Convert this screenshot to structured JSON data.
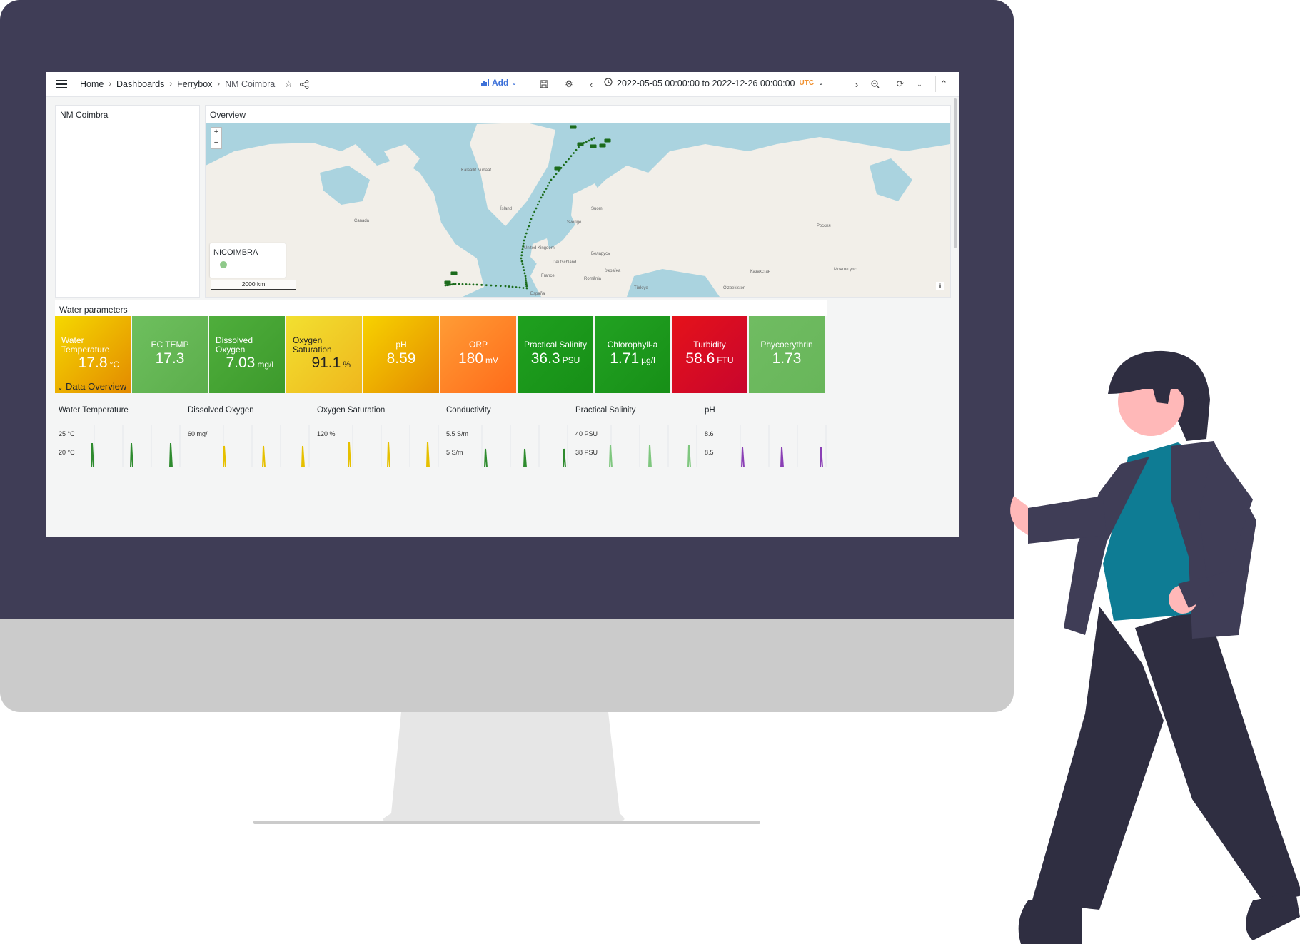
{
  "topbar": {
    "breadcrumbs": [
      "Home",
      "Dashboards",
      "Ferrybox",
      "NM Coimbra"
    ],
    "add_label": "Add",
    "time_range": "2022-05-05 00:00:00 to 2022-12-26 00:00:00",
    "timezone": "UTC"
  },
  "panels": {
    "text_panel_title": "NM Coimbra",
    "overview_title": "Overview",
    "map": {
      "zoom_in": "+",
      "zoom_out": "−",
      "legend_name": "NICOIMBRA",
      "scale_label": "2000 km",
      "info": "i",
      "labels": {
        "greenland": "Kalaallit Nunaat",
        "iceland": "Ísland",
        "canada": "Canada",
        "russia": "Россия",
        "kazakhstan": "Казахстан",
        "mongolia": "Монгол улс",
        "france": "France",
        "deutschland": "Deutschland",
        "uk": "United Kingdom",
        "ukraine": "Україна",
        "sverige": "Sverige",
        "suomi": "Suomi",
        "espana": "España",
        "belarus": "Беларусь",
        "romania": "România",
        "turkey": "Türkiye",
        "uzbek": "O'zbekiston"
      }
    },
    "water_title": "Water parameters",
    "tiles": [
      {
        "label1": "Water",
        "label2": "Temperature",
        "value": "17.8",
        "unit": "°C",
        "color1": "#f5d800",
        "color2": "#e38a00"
      },
      {
        "label1": "EC TEMP",
        "label2": "",
        "value": "17.3",
        "unit": "",
        "color1": "#6ebf5e",
        "color2": "#5cae4c"
      },
      {
        "label1": "Dissolved",
        "label2": "Oxygen",
        "value": "7.03",
        "unit": "mg/l",
        "color1": "#4fae3c",
        "color2": "#3d9a2c"
      },
      {
        "label1": "Oxygen",
        "label2": "Saturation",
        "value": "91.1",
        "unit": "%",
        "color1": "#f2e030",
        "color2": "#efb71d"
      },
      {
        "label1": "pH",
        "label2": "",
        "value": "8.59",
        "unit": "",
        "color1": "#f7d200",
        "color2": "#e48b00"
      },
      {
        "label1": "ORP",
        "label2": "",
        "value": "180",
        "unit": "mV",
        "color1": "#ff9c35",
        "color2": "#ff6b1a"
      },
      {
        "label1": "Practical Salinity",
        "label2": "",
        "value": "36.3",
        "unit": "PSU",
        "color1": "#1fa01f",
        "color2": "#178f17"
      },
      {
        "label1": "Chlorophyll-a",
        "label2": "",
        "value": "1.71",
        "unit": "µg/l",
        "color1": "#22a222",
        "color2": "#178f17"
      },
      {
        "label1": "Turbidity",
        "label2": "",
        "value": "58.6",
        "unit": "FTU",
        "color1": "#e5121a",
        "color2": "#c8052d"
      },
      {
        "label1": "Phycoerythrin",
        "label2": "",
        "value": "1.73",
        "unit": "",
        "color1": "#70bc62",
        "color2": "#68b65a"
      }
    ],
    "data_overview": {
      "title": "Data Overview",
      "charts": [
        {
          "title": "Water Temperature",
          "ticks": [
            "25 °C",
            "20 °C"
          ],
          "color": "#2e8b2e"
        },
        {
          "title": "Dissolved Oxygen",
          "ticks": [
            "60 mg/l"
          ],
          "color": "#e6c000"
        },
        {
          "title": "Oxygen Saturation",
          "ticks": [
            "120 %"
          ],
          "color": "#e6c000"
        },
        {
          "title": "Conductivity",
          "ticks": [
            "5.5 S/m",
            "5 S/m"
          ],
          "color": "#2e8b2e"
        },
        {
          "title": "Practical Salinity",
          "ticks": [
            "40 PSU",
            "38 PSU"
          ],
          "color": "#7fc77f"
        },
        {
          "title": "pH",
          "ticks": [
            "8.6",
            "8.5"
          ],
          "color": "#8a3fb5"
        }
      ]
    }
  }
}
